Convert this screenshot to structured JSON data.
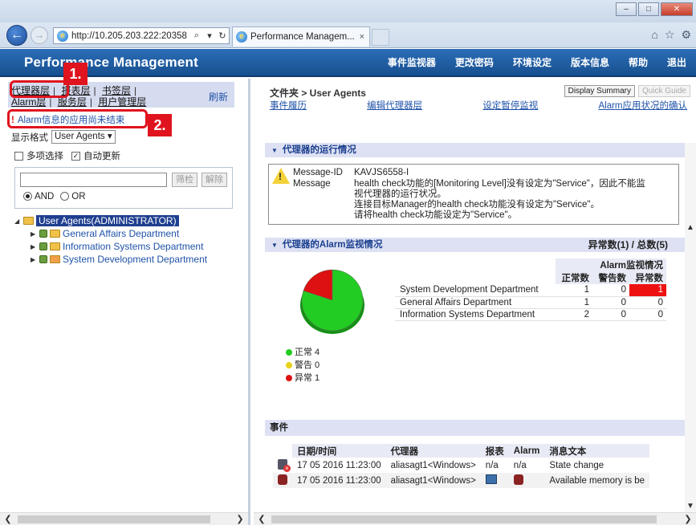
{
  "browser": {
    "url": "http://10.205.203.222:20358",
    "tab_title": "Performance Managem...",
    "tab_close": "×",
    "search_glyph": "⌕",
    "dropdown_glyph": "▾",
    "refresh_glyph": "↻",
    "back_glyph": "←",
    "forward_glyph": "→",
    "window_buttons": {
      "minimize": "–",
      "maximize": "□",
      "close": "✕"
    },
    "tool_icons": {
      "home": "⌂",
      "favorites": "☆",
      "settings": "⚙"
    }
  },
  "app": {
    "title": "Performance Management",
    "menu": [
      "事件监视器",
      "更改密码",
      "环境设定",
      "版本信息",
      "帮助",
      "退出"
    ]
  },
  "left": {
    "tabs_row1": [
      "代理器层",
      "报表层",
      "书签层"
    ],
    "tabs_row2": [
      "Alarm层",
      "服务层",
      "用户管理层"
    ],
    "refresh": "刷新",
    "alarm_notice": "Alarm信息的应用尚未结束",
    "format_label": "显示格式",
    "format_value": "User Agents",
    "multi_select": "多项选择",
    "auto_update": "自动更新",
    "filter_button": "筛检",
    "clear_button": "解除",
    "and_label": "AND",
    "or_label": "OR",
    "tree_root": "User Agents(ADMINISTRATOR)",
    "tree_items": [
      "General Affairs Department",
      "Information Systems Department",
      "System Development Department"
    ]
  },
  "annotations": {
    "label1": "1.",
    "label2": "2."
  },
  "right": {
    "breadcrumb": "文件夹 > User Agents",
    "display_summary": "Display Summary",
    "quick_guide": "Quick Guide",
    "sublinks": [
      "事件履历",
      "编辑代理器层",
      "设定暂停监视",
      "Alarm应用状况的确认"
    ],
    "agent_status_title": "代理器的运行情况",
    "message_id_label": "Message-ID",
    "message_id": "KAVJS6558-I",
    "message_label": "Message",
    "message_lines": [
      "health check功能的[Monitoring Level]没有设定为\"Service\"，因此不能监",
      "视代理器的运行状况。",
      "连接目标Manager的health check功能没有设定为\"Service\"。",
      "请将health check功能设定为\"Service\"。"
    ],
    "alarm_status_title": "代理器的Alarm监视情况",
    "alarm_counts": "异常数(1) / 总数(5)",
    "table_group_header": "Alarm监视情况",
    "table_headers": [
      "正常数",
      "警告数",
      "异常数"
    ],
    "rows": [
      {
        "name": "System Development Department",
        "normal": "1",
        "warning": "0",
        "abnormal": "1"
      },
      {
        "name": "General Affairs Department",
        "normal": "1",
        "warning": "0",
        "abnormal": "0"
      },
      {
        "name": "Information Systems Department",
        "normal": "2",
        "warning": "0",
        "abnormal": "0"
      }
    ],
    "legend": [
      {
        "label": "正常 4",
        "color": "#22cc22"
      },
      {
        "label": "警告 0",
        "color": "#e8d21a"
      },
      {
        "label": "异常 1",
        "color": "#dd1111"
      }
    ],
    "events_title": "事件",
    "events_headers": [
      "日期/时间",
      "代理器",
      "报表",
      "Alarm",
      "消息文本"
    ],
    "events": [
      {
        "datetime": "17 05 2016 11:23:00",
        "agent": "aliasagt1<Windows>",
        "report": "n/a",
        "alarm": "n/a",
        "message": "State change"
      },
      {
        "datetime": "17 05 2016 11:23:00",
        "agent": "aliasagt1<Windows>",
        "report": "",
        "alarm": "",
        "message": "Available memory is be"
      }
    ]
  },
  "chart_data": {
    "type": "pie",
    "categories": [
      "正常",
      "警告",
      "异常"
    ],
    "values": [
      4,
      0,
      1
    ],
    "colors": [
      "#22cc22",
      "#e8d21a",
      "#dd1111"
    ]
  }
}
